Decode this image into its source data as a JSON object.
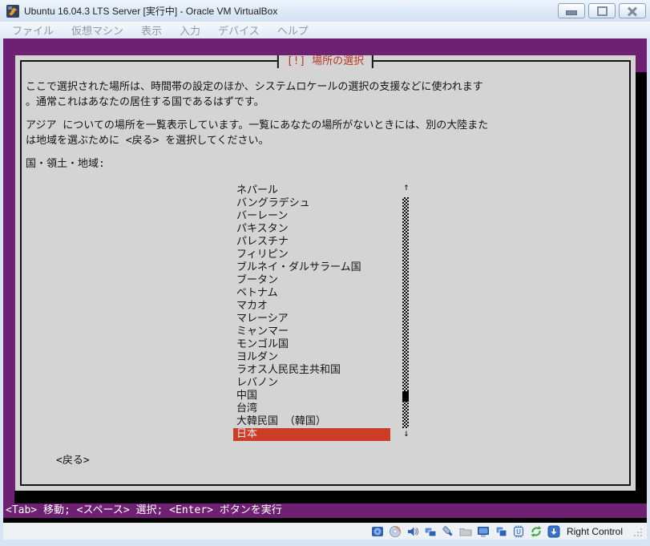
{
  "window": {
    "title": "Ubuntu 16.04.3 LTS Server [実行中] - Oracle VM VirtualBox"
  },
  "menubar": {
    "items": [
      "ファイル",
      "仮想マシン",
      "表示",
      "入力",
      "デバイス",
      "ヘルプ"
    ]
  },
  "installer": {
    "dialog_title": "[!] 場所の選択",
    "intro_lines": [
      "ここで選択された場所は、時間帯の設定のほか、システムロケールの選択の支援などに使われます",
      "。通常これはあなたの居住する国であるはずです。"
    ],
    "scope_lines": [
      "アジア についての場所を一覧表示しています。一覧にあなたの場所がないときには、別の大陸また",
      "は地域を選ぶために <戻る> を選択してください。"
    ],
    "list_label": "国・領土・地域:",
    "countries": [
      "ネパール",
      "バングラデシュ",
      "バーレーン",
      "パキスタン",
      "パレスチナ",
      "フィリピン",
      "ブルネイ・ダルサラーム国",
      "ブータン",
      "ベトナム",
      "マカオ",
      "マレーシア",
      "ミャンマー",
      "モンゴル国",
      "ヨルダン",
      "ラオス人民民主共和国",
      "レバノン",
      "中国",
      "台湾",
      "大韓民国 （韓国）",
      "日本"
    ],
    "selected_country": "日本",
    "selected_index": 19,
    "scrollbar": {
      "up_arrow": "↑",
      "down_arrow": "↓"
    },
    "back_button": "<戻る>",
    "help_line": "<Tab> 移動; <スペース> 選択; <Enter> ボタンを実行"
  },
  "statusbar": {
    "icons": [
      "hdd-icon",
      "optical-disc-icon",
      "audio-icon",
      "network-icon",
      "usb-icon",
      "shared-folders-icon",
      "display-icon",
      "virtual-screens-icon",
      "features-icon",
      "mouse-integration-icon",
      "host-key-state-icon"
    ],
    "host_key_label": "Right Control"
  },
  "colors": {
    "vm_background": "#6e2173",
    "dialog_background": "#d4d4d4",
    "dialog_title_red": "#b93526",
    "selection_red": "#cd3c28",
    "help_text": "#ffffff"
  }
}
